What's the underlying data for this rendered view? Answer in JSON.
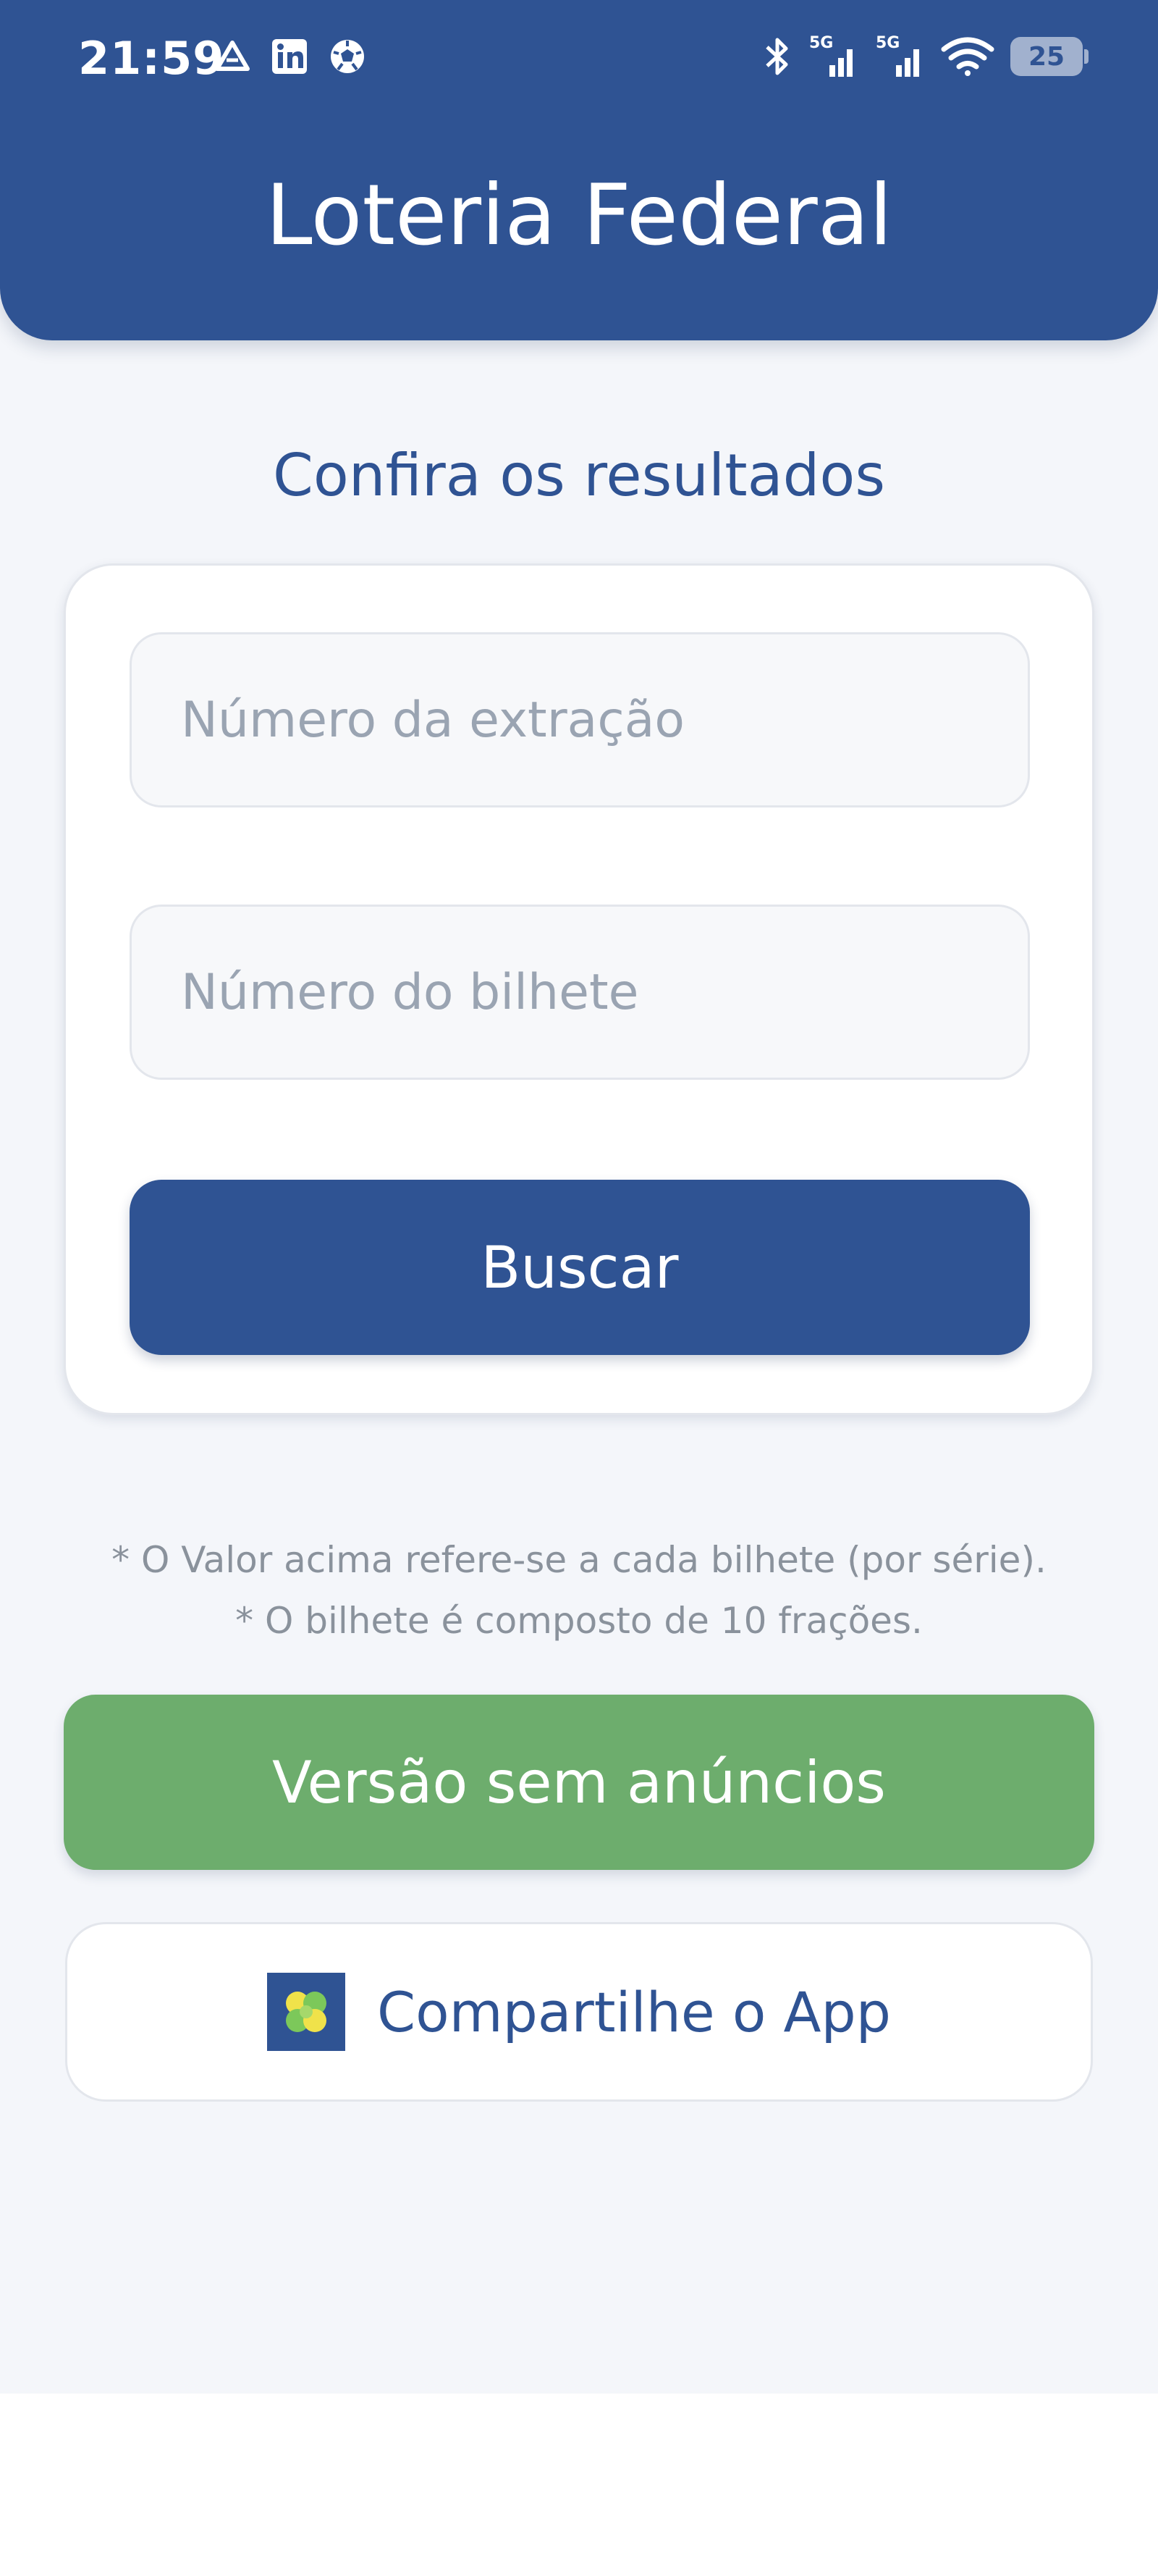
{
  "status_bar": {
    "time": "21:59",
    "battery_level": "25",
    "network_label": "5G",
    "left_icons": [
      "drive-icon",
      "linkedin-icon",
      "soccer-ball-icon"
    ],
    "right_icons": [
      "bluetooth-icon",
      "signal-5g-icon",
      "signal-5g-icon",
      "wifi-icon",
      "battery-icon"
    ]
  },
  "header": {
    "title": "Loteria Federal",
    "color": "#2f5393"
  },
  "main": {
    "section_title": "Confira os resultados",
    "extraction_field": {
      "placeholder": "Número da extração",
      "value": ""
    },
    "ticket_field": {
      "placeholder": "Número do bilhete",
      "value": ""
    },
    "search_button": "Buscar",
    "notes": [
      "* O Valor acima refere-se a cada bilhete (por série).",
      "* O bilhete é composto de 10 frações."
    ],
    "no_ads_button": "Versão sem anúncios",
    "no_ads_color": "#6dad6d",
    "share_button": "Compartilhe o App",
    "share_icon": "clover-icon"
  }
}
